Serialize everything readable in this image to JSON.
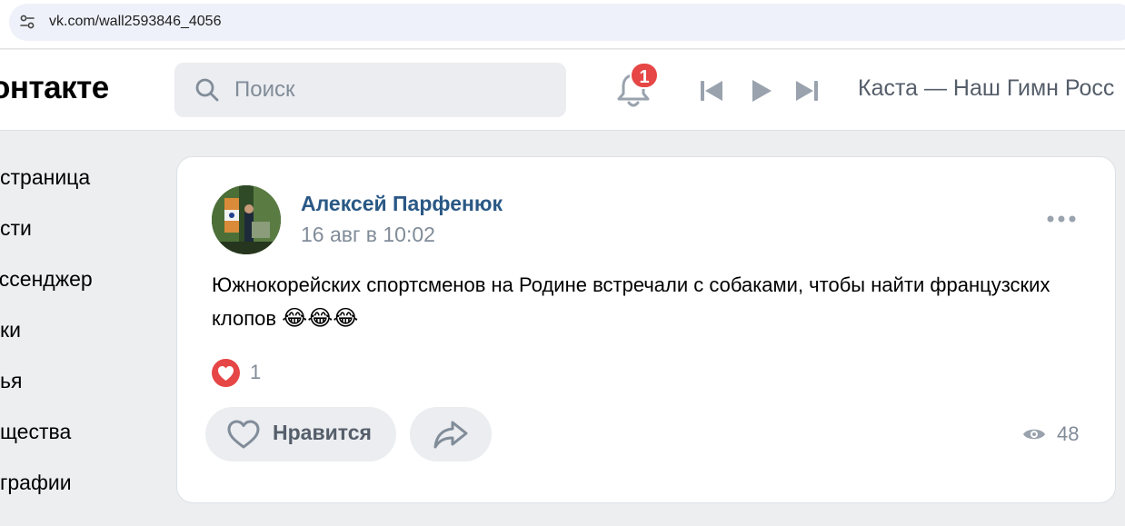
{
  "browser": {
    "url": "vk.com/wall2593846_4056"
  },
  "header": {
    "logo_text": "онтакте",
    "search_placeholder": "Поиск",
    "notifications_count": "1",
    "now_playing": "Каста — Наш Гимн Росс"
  },
  "sidebar": {
    "items": [
      {
        "label": "страница"
      },
      {
        "label": "сти"
      },
      {
        "label": "ессенджер"
      },
      {
        "label": "ки"
      },
      {
        "label": "ья"
      },
      {
        "label": "щества"
      },
      {
        "label": "графии"
      }
    ]
  },
  "post": {
    "author": "Алексей Парфенюк",
    "date": "16 авг в 10:02",
    "text": "Южнокорейских спортсменов на Родине встречали с собаками, чтобы найти французских клопов",
    "emoji": "😂😂😂",
    "reactions_count": "1",
    "like_label": "Нравится",
    "views": "48"
  },
  "colors": {
    "accent_link": "#2a5885",
    "badge": "#e64646",
    "secondary_text": "#818c99",
    "button_bg": "#ebedf0"
  }
}
